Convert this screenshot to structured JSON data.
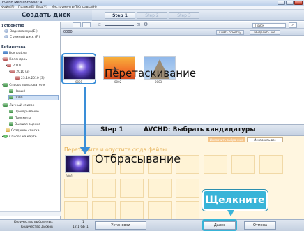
{
  "window": {
    "title": "Everio MediaBrowser 4"
  },
  "menu": [
    "Файл(F)",
    "Правка(E)",
    "Вид(V)",
    "Инструменты(T)",
    "Справка(H)"
  ],
  "header": {
    "create_disc": "Создать диск",
    "steps": [
      "Step 1",
      "Step 2",
      "Step 3"
    ]
  },
  "left_panel": {
    "devices_head": "Устройство",
    "devices": [
      "Видеокамера(E:)",
      "Съемный диск (F:)"
    ],
    "library_head": "Библиотека",
    "library": [
      "Все файлы",
      "Календарь",
      "2010",
      "2010 (3)",
      "23.10.2010 (3)",
      "Список пользователя",
      "Новый",
      "0000",
      "Личный список",
      "Проигрывание",
      "Просмотр",
      "Высшая оценка",
      "Создание списка",
      "Список на карте"
    ]
  },
  "toolbar": {
    "search_placeholder": "Поиск"
  },
  "upper": {
    "count": "0000",
    "deselect_all": "Снять отметку",
    "select_all": "Выделить все",
    "thumbs": [
      "0001",
      "0002",
      "0003"
    ],
    "drag_label": "Перетаскивание"
  },
  "lower": {
    "step": "Step 1",
    "title": "AVCHD: Выбрать кандидатуры",
    "remove_selected": "Исключить выбранные",
    "remove_all": "Исключить все",
    "drop_hint": "Перетащите и опустите сюда файлы.",
    "drop_label": "Отбрасывание",
    "drop_thumb": "0001"
  },
  "statusbar": {
    "file_count_label": "Количество выбранных",
    "file_count": "1",
    "disc_count_label": "Количество дисков",
    "disc_count": "1",
    "size": "12.1 Gb",
    "settings": "Установки",
    "next": "Далее",
    "cancel": "Отмена"
  },
  "callout": {
    "text": "Щелкните"
  },
  "colors": {
    "accent": "#3a8ed8",
    "callout": "#38b4d8",
    "drop_area": "#fff6e0"
  }
}
